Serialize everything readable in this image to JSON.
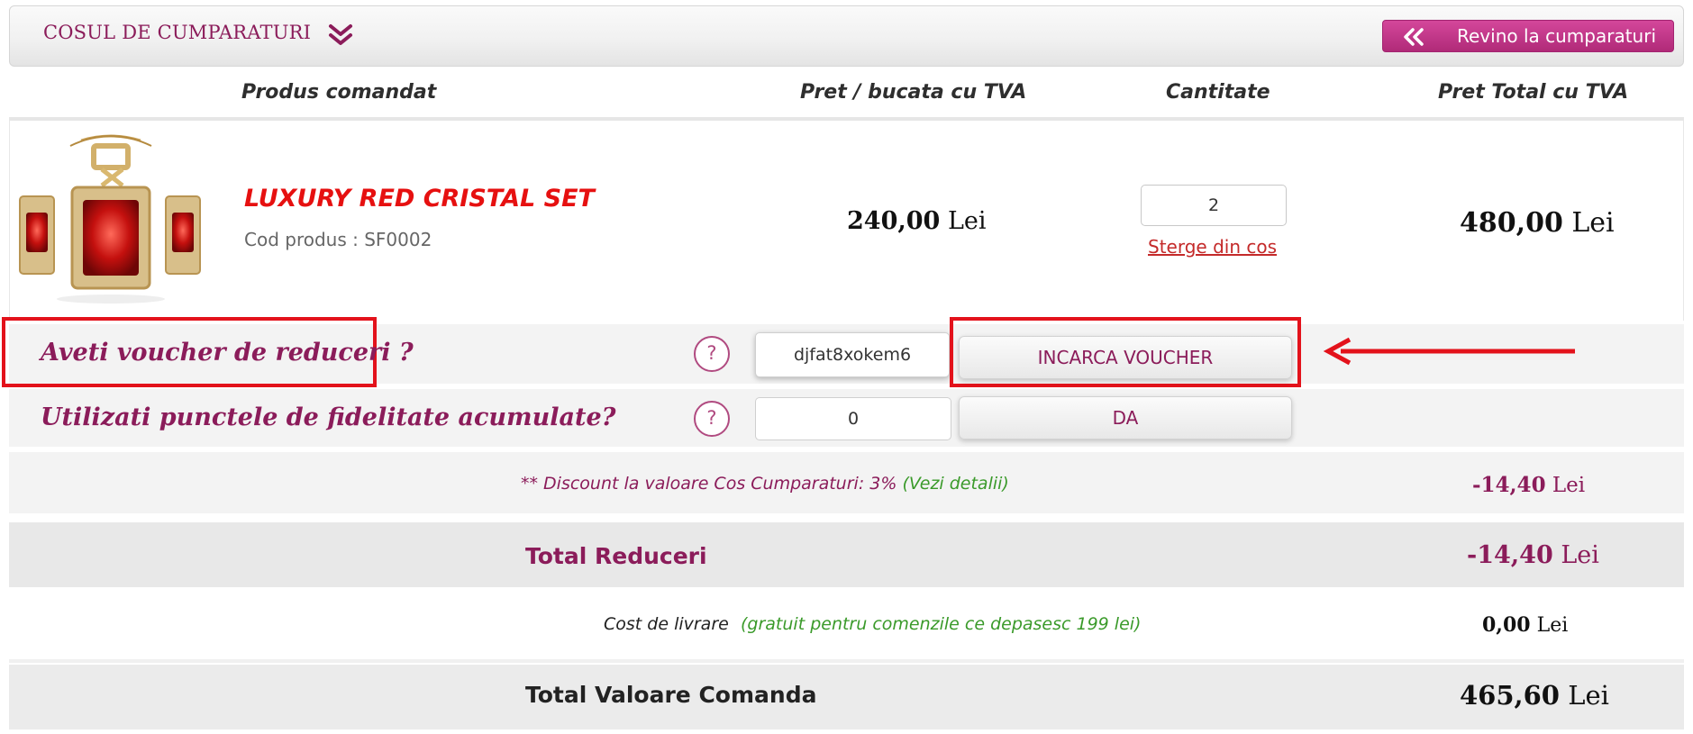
{
  "header": {
    "title": "COSUL DE CUMPARATURI",
    "back_button_label": "Revino la cumparaturi"
  },
  "columns": {
    "product": "Produs comandat",
    "unit_price": "Pret / bucata cu TVA",
    "quantity": "Cantitate",
    "total_price": "Pret Total cu TVA"
  },
  "item": {
    "name": "LUXURY RED CRISTAL SET",
    "code": "Cod produs : SF0002",
    "unit_price_value": "240,00",
    "unit_price_currency": "Lei",
    "quantity": "2",
    "remove_label": "Sterge din cos",
    "total_value": "480,00",
    "total_currency": "Lei"
  },
  "voucher": {
    "label": "Aveti voucher de reduceri ?",
    "help": "?",
    "code_value": "djfat8xokem6",
    "button_label": "INCARCA VOUCHER"
  },
  "fidelity": {
    "label": "Utilizati punctele de fidelitate acumulate?",
    "help": "?",
    "points_value": "0",
    "button_label": "DA"
  },
  "discount": {
    "text": "** Discount la valoare Cos Cumparaturi: 3%",
    "details_link": "(Vezi detalii)",
    "value": "-14,40",
    "currency": "Lei"
  },
  "total_reduceri": {
    "label": "Total Reduceri",
    "value": "-14,40",
    "currency": "Lei"
  },
  "delivery": {
    "label": "Cost de livrare",
    "note": "(gratuit pentru comenzile ce depasesc 199 lei)",
    "value": "0,00",
    "currency": "Lei"
  },
  "grand_total": {
    "label": "Total Valoare Comanda",
    "value": "465,60",
    "currency": "Lei"
  },
  "colors": {
    "brand": "#8b1c5a",
    "button_pink": "#c0398a",
    "product_red": "#e61010",
    "highlight_red": "#e3121b",
    "note_green": "#3a9a2a"
  },
  "icons": {
    "header": "double-chevron-down-icon",
    "back": "double-chevron-left-icon",
    "help": "question-circle-icon",
    "annotation": "arrow-left-icon"
  }
}
